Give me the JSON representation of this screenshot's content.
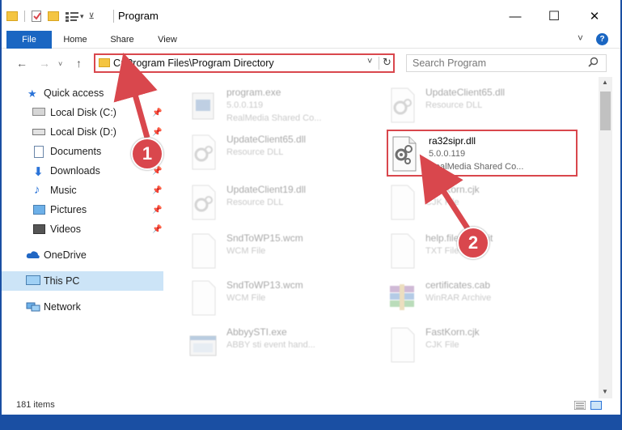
{
  "window": {
    "title": "Program",
    "min_glyph": "—",
    "max_glyph": "☐",
    "close_glyph": "✕"
  },
  "ribbon": {
    "tabs": [
      "File",
      "Home",
      "Share",
      "View"
    ],
    "expand_glyph": "⌄",
    "help_glyph": "?"
  },
  "address": {
    "path": "C:\\Program Files\\Program Directory",
    "search_placeholder": "Search Program"
  },
  "sidebar": {
    "items": [
      {
        "label": "Quick access",
        "icon": "star-icon",
        "pinned": false
      },
      {
        "label": "Local Disk (C:)",
        "icon": "drive-icon",
        "pinned": true
      },
      {
        "label": "Local Disk (D:)",
        "icon": "drive-icon",
        "pinned": true
      },
      {
        "label": "Documents",
        "icon": "documents-icon",
        "pinned": true
      },
      {
        "label": "Downloads",
        "icon": "download-icon",
        "pinned": true
      },
      {
        "label": "Music",
        "icon": "music-icon",
        "pinned": true
      },
      {
        "label": "Pictures",
        "icon": "pictures-icon",
        "pinned": true
      },
      {
        "label": "Videos",
        "icon": "videos-icon",
        "pinned": true
      },
      {
        "label": "OneDrive",
        "icon": "cloud-icon",
        "pinned": false
      },
      {
        "label": "This PC",
        "icon": "pc-icon",
        "pinned": false,
        "selected": true
      },
      {
        "label": "Network",
        "icon": "network-icon",
        "pinned": false
      }
    ]
  },
  "files": [
    {
      "name": "program.exe",
      "line2": "5.0.0.119",
      "line3": "RealMedia Shared Co...",
      "icon": "exe-icon",
      "faded": true
    },
    {
      "name": "UpdateClient65.dll",
      "line2": "Resource DLL",
      "line3": "",
      "icon": "dll-gear-icon",
      "faded": true
    },
    {
      "name": "UpdateClient65.dll",
      "line2": "Resource DLL",
      "line3": "",
      "icon": "dll-gear-icon",
      "faded": true
    },
    {
      "name": "ra32sipr.dll",
      "line2": "5.0.0.119",
      "line3": "RealMedia Shared Co...",
      "icon": "dll-gear-icon",
      "faded": false
    },
    {
      "name": "UpdateClient19.dll",
      "line2": "Resource DLL",
      "line3": "",
      "icon": "dll-gear-icon",
      "faded": true
    },
    {
      "name": "FastKorn.cjk",
      "line2": "CJK File",
      "line3": "",
      "icon": "blank-file-icon",
      "faded": true
    },
    {
      "name": "SndToWP15.wcm",
      "line2": "WCM File",
      "line3": "",
      "icon": "blank-file-icon",
      "faded": true
    },
    {
      "name": "help.file.colorbit",
      "line2": "TXT File",
      "line3": "",
      "icon": "blank-file-icon",
      "faded": true
    },
    {
      "name": "SndToWP13.wcm",
      "line2": "WCM File",
      "line3": "",
      "icon": "blank-file-icon",
      "faded": true
    },
    {
      "name": "certificates.cab",
      "line2": "WinRAR Archive",
      "line3": "",
      "icon": "winrar-icon",
      "faded": true
    },
    {
      "name": "AbbyySTI.exe",
      "line2": "ABBY sti event hand...",
      "line3": "",
      "icon": "exe-icon",
      "faded": true
    },
    {
      "name": "FastKorn.cjk",
      "line2": "CJK File",
      "line3": "",
      "icon": "blank-file-icon",
      "faded": true
    }
  ],
  "status": {
    "item_count": "181 items"
  },
  "markers": {
    "one": "1",
    "two": "2"
  },
  "colors": {
    "accent": "#1a66c2",
    "highlight": "#d9474d",
    "selected_bg": "#cce4f7",
    "desktop": "#1a4fa3"
  }
}
